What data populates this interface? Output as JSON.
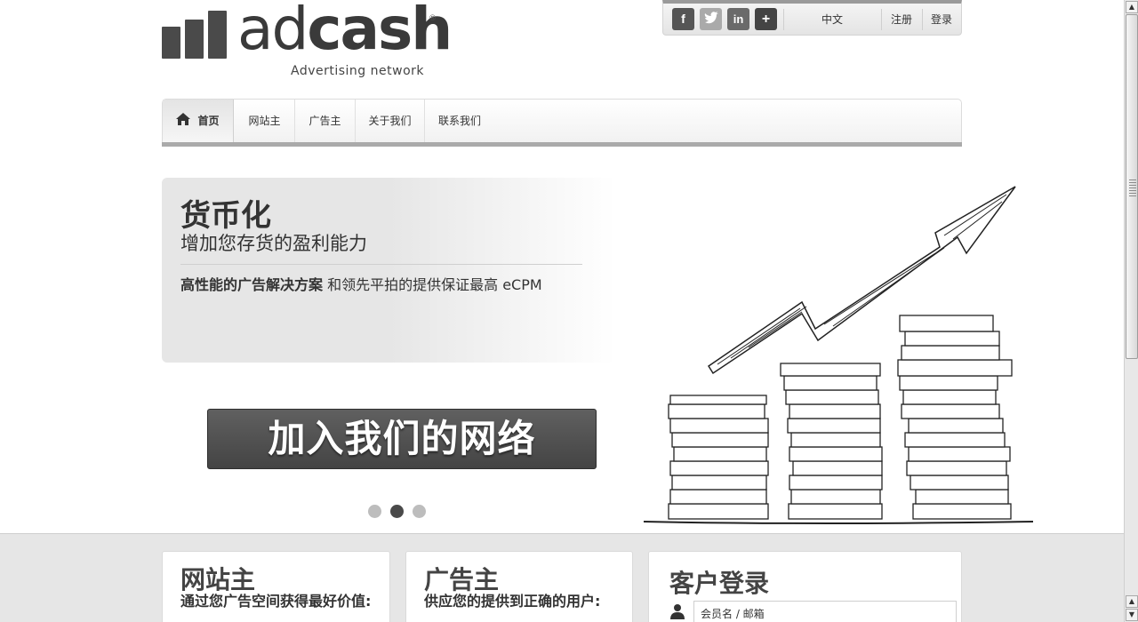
{
  "logo": {
    "word_light": "ad",
    "word_bold": "cash",
    "reg_mark": "®",
    "tagline": "Advertising network"
  },
  "topbar": {
    "social": [
      {
        "name": "facebook",
        "glyph": "f"
      },
      {
        "name": "twitter",
        "glyph": "t"
      },
      {
        "name": "linkedin",
        "glyph": "in"
      },
      {
        "name": "more",
        "glyph": "+"
      }
    ],
    "language": "中文",
    "register": "注册",
    "login": "登录"
  },
  "nav": {
    "items": [
      {
        "label": "首页",
        "active": true,
        "icon": "home-icon"
      },
      {
        "label": "网站主"
      },
      {
        "label": "广告主"
      },
      {
        "label": "关于我们"
      },
      {
        "label": "联系我们"
      }
    ]
  },
  "hero": {
    "title": "货币化",
    "subtitle": "增加您存货的盈利能力",
    "text_bold": "高性能的广告解决方案",
    "text_rest": " 和领先平拍的提供保证最高 eCPM",
    "cta": "加入我们的网络",
    "slides": 3,
    "active_slide": 2
  },
  "cards": {
    "publisher": {
      "title": "网站主",
      "subtitle": "通过您广告空间获得最好价值:"
    },
    "advertiser": {
      "title": "广告主",
      "subtitle": "供应您的提供到正确的用户:"
    },
    "login": {
      "title": "客户登录",
      "username_placeholder": "会员名 / 邮箱"
    }
  },
  "colors": {
    "accent": "#444444",
    "band": "#e6e6e6"
  }
}
